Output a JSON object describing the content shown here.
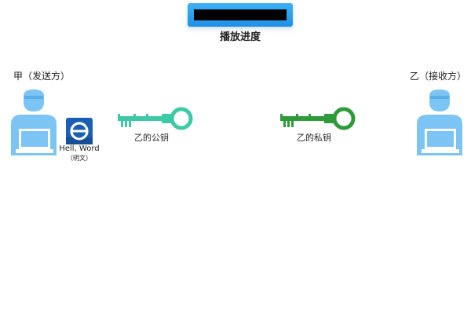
{
  "progress": {
    "label": "播放进度",
    "fraction": 0
  },
  "sender": {
    "label": "甲（发送方）"
  },
  "receiver": {
    "label": "乙（接收方）"
  },
  "document": {
    "title": "Hell, Word",
    "subtitle": "（明文）",
    "icon": "document-icon"
  },
  "public_key": {
    "label": "乙的公钥",
    "color": "#3ec9a6"
  },
  "private_key": {
    "label": "乙的私钥",
    "color": "#2e9b3a"
  },
  "colors": {
    "person": "#7cc4f4",
    "progress_blue": "#1e90e6",
    "document_blue": "#1a5fb4"
  }
}
